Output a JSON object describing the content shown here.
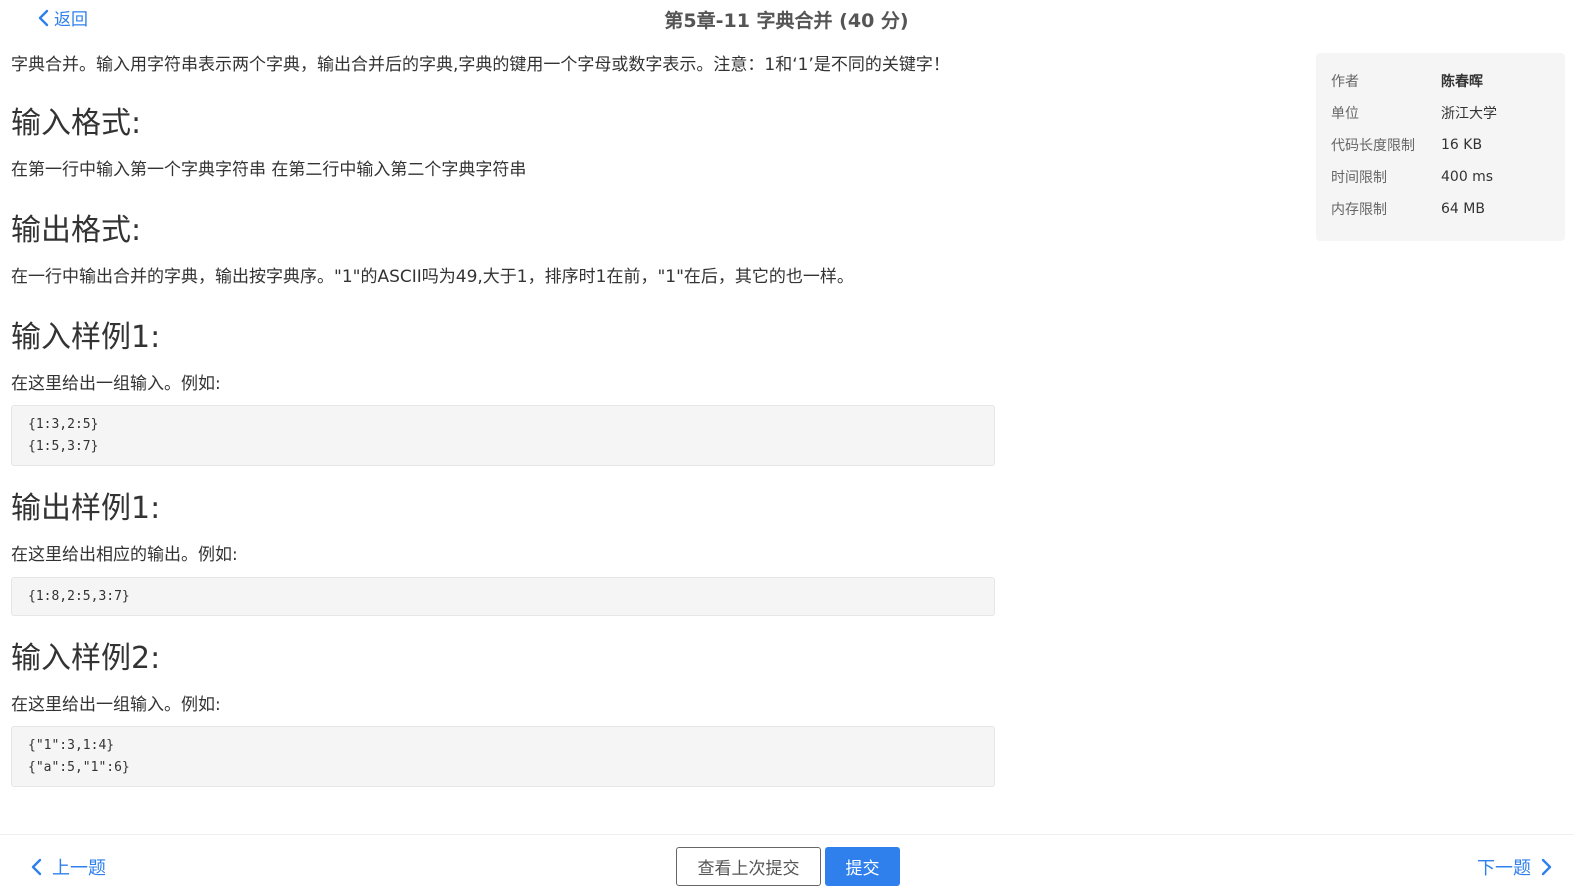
{
  "header": {
    "back_label": "返回",
    "title": "第5章-11 字典合并 (40 分)"
  },
  "problem": {
    "description": "字典合并。输入用字符串表示两个字典，输出合并后的字典,字典的键用一个字母或数字表示。注意：1和‘1’是不同的关键字！",
    "input_heading": "输入格式:",
    "input_desc": "在第一行中输入第一个字典字符串 在第二行中输入第二个字典字符串",
    "output_heading": "输出格式:",
    "output_desc": "在一行中输出合并的字典，输出按字典序。\"1\"的ASCII吗为49,大于1，排序时1在前，\"1\"在后，其它的也一样。",
    "sample_input1_heading": "输入样例1:",
    "sample_input1_note": "在这里给出一组输入。例如:",
    "sample_input1_code": "{1:3,2:5}\n{1:5,3:7}",
    "sample_output1_heading": "输出样例1:",
    "sample_output1_note": "在这里给出相应的输出。例如:",
    "sample_output1_code": "{1:8,2:5,3:7}",
    "sample_input2_heading": "输入样例2:",
    "sample_input2_note": "在这里给出一组输入。例如:",
    "sample_input2_code": "{\"1\":3,1:4}\n{\"a\":5,\"1\":6}"
  },
  "meta": {
    "author_label": "作者",
    "author_value": "陈春晖",
    "unit_label": "单位",
    "unit_value": "浙江大学",
    "code_limit_label": "代码长度限制",
    "code_limit_value": "16 KB",
    "time_limit_label": "时间限制",
    "time_limit_value": "400 ms",
    "memory_limit_label": "内存限制",
    "memory_limit_value": "64 MB"
  },
  "footer": {
    "prev_label": "上一题",
    "view_last_label": "查看上次提交",
    "submit_label": "提交",
    "next_label": "下一题"
  },
  "colors": {
    "accent": "#2f80ed",
    "code_bg": "#f5f5f5",
    "sidebar_bg": "#f5f5f5"
  }
}
